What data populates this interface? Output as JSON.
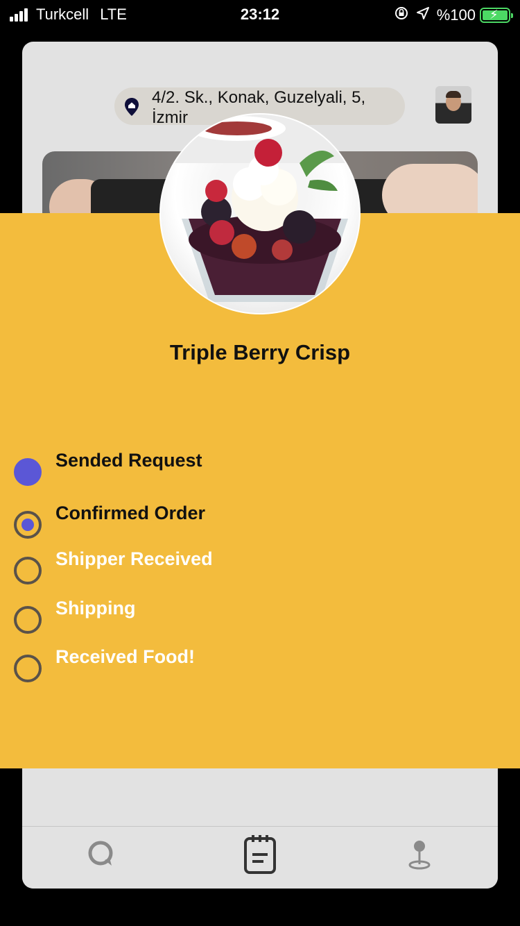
{
  "status_bar": {
    "carrier": "Turkcell",
    "network": "LTE",
    "time": "23:12",
    "battery": "%100"
  },
  "header": {
    "address": "4/2. Sk., Konak, Guzelyali, 5, İzmir"
  },
  "order": {
    "title": "Triple Berry Crisp",
    "steps": [
      {
        "label": "Sended Request",
        "state": "done"
      },
      {
        "label": "Confirmed Order",
        "state": "current"
      },
      {
        "label": "Shipper Received",
        "state": "pending"
      },
      {
        "label": "Shipping",
        "state": "pending"
      },
      {
        "label": "Received Food!",
        "state": "pending"
      }
    ]
  },
  "colors": {
    "sheet": "#f3bc3d",
    "accent": "#5b57d6"
  },
  "tabs": [
    {
      "icon": "chat-icon"
    },
    {
      "icon": "order-list-icon"
    },
    {
      "icon": "location-pin-icon"
    }
  ]
}
